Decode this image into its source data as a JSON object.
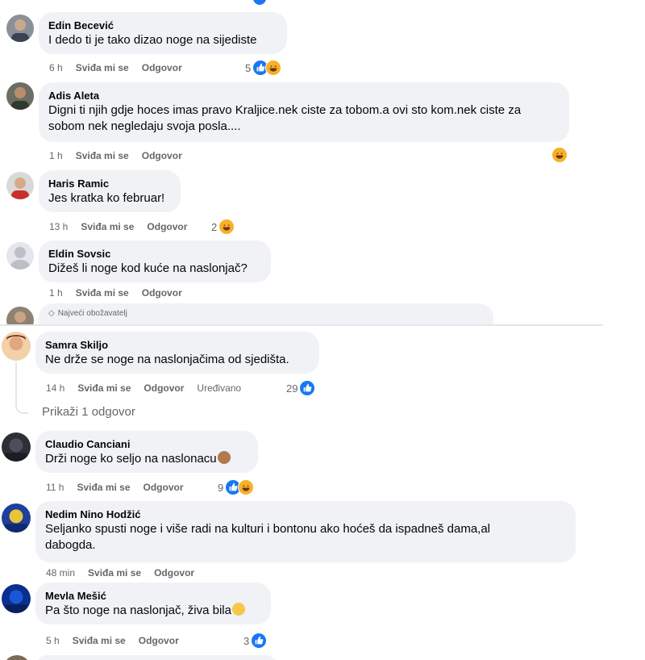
{
  "top_comments": [
    {
      "name": "Edin Becević",
      "text": "I dedo ti je tako dizao noge na sijediste",
      "time": "6 h",
      "like": "Sviđa mi se",
      "reply": "Odgovor",
      "count": "5",
      "reactions": [
        "like",
        "haha"
      ]
    },
    {
      "name": "Adis Aleta",
      "text": "Digni ti njih gdje hoces imas pravo Kraljice.nek ciste za tobom.a ovi sto kom.nek ciste za sobom nek negledaju svoja posla....",
      "time": "1 h",
      "like": "Sviđa mi se",
      "reply": "Odgovor",
      "count": "",
      "reactions": [
        "haha"
      ]
    },
    {
      "name": "Haris Ramic",
      "text": "Jes kratka ko februar!",
      "time": "13 h",
      "like": "Sviđa mi se",
      "reply": "Odgovor",
      "count": "2",
      "reactions": [
        "haha"
      ]
    },
    {
      "name": "Eldin Sovsic",
      "text": "Dižeš li noge kod kuće na naslonjač?",
      "time": "1 h",
      "like": "Sviđa mi se",
      "reply": "Odgovor",
      "count": "",
      "reactions": []
    }
  ],
  "partial_comment": {
    "badge": "Najveći obožavatelj"
  },
  "bottom_comments": [
    {
      "name": "Samra Skiljo",
      "text": "Ne drže se noge na naslonjačima od sjedišta.",
      "time": "14 h",
      "like": "Sviđa mi se",
      "reply": "Odgovor",
      "edited": "Uređivano",
      "count": "29",
      "reactions": [
        "like"
      ]
    },
    {
      "name": "Claudio Canciani",
      "text": "Drži noge ko seljo na naslonacu",
      "time": "11 h",
      "like": "Sviđa mi se",
      "reply": "Odgovor",
      "count": "9",
      "reactions": [
        "like",
        "haha"
      ]
    },
    {
      "name": "Nedim Nino Hodžić",
      "text": "Seljanko spusti noge i više radi na kulturi i bontonu ako hoćeš da ispadneš dama,al dabogda.",
      "time": "48 min",
      "like": "Sviđa mi se",
      "reply": "Odgovor",
      "count": "",
      "reactions": []
    },
    {
      "name": "Mevla Mešić",
      "text": "Pa što noge na naslonjač, živa bila",
      "time": "5 h",
      "like": "Sviđa mi se",
      "reply": "Odgovor",
      "count": "3",
      "reactions": [
        "like"
      ]
    }
  ],
  "show_replies": "Prikaži 1 odgovor",
  "colors": {
    "bubble": "#f0f2f5",
    "like_blue": "#1877f2",
    "haha_yellow": "#f7b125",
    "meta_gray": "#65676b"
  }
}
